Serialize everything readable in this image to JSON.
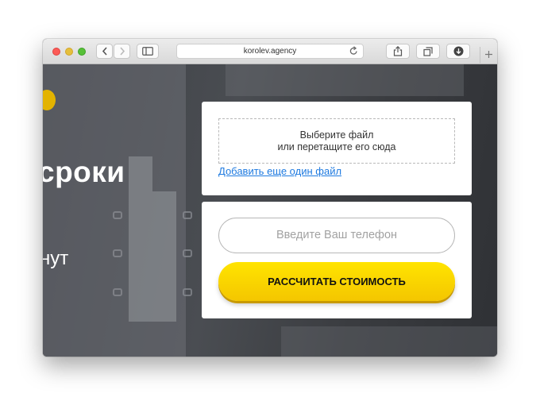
{
  "browser": {
    "url": "korolev.agency",
    "icons": {
      "back": "chevron-left-icon",
      "forward": "chevron-right-icon",
      "sidebar": "sidebar-icon",
      "reload": "reload-icon",
      "share": "share-icon",
      "tabs": "tabs-icon",
      "download": "download-icon",
      "new_tab": "plus-icon"
    }
  },
  "hero": {
    "headline_fragment": "сроки",
    "subline_fragment": "нут"
  },
  "upload_card": {
    "dropzone_line1": "Выберите файл",
    "dropzone_line2": "или перетащите его сюда",
    "add_file_link": "Добавить еще один файл"
  },
  "contact_card": {
    "phone_placeholder": "Введите Ваш телефон",
    "submit_label": "РАССЧИТАТЬ СТОИМОСТЬ"
  },
  "colors": {
    "accent_yellow": "#ffe000",
    "link_blue": "#1e7ae0"
  }
}
